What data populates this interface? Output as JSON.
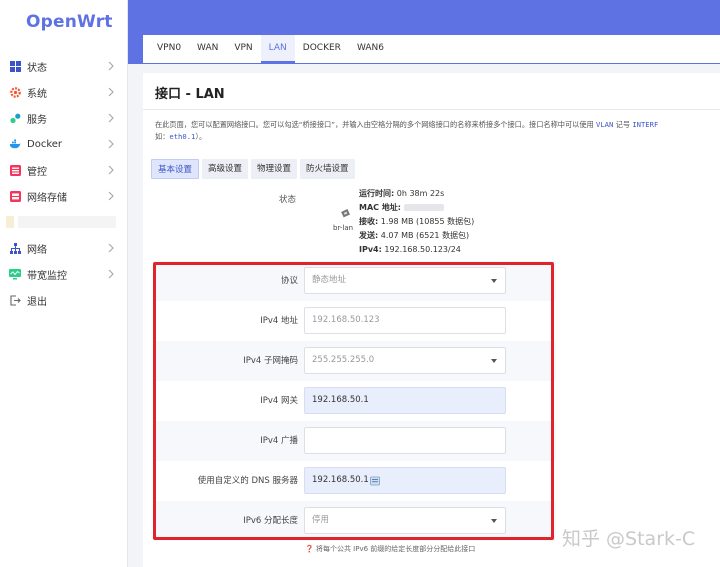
{
  "brand": {
    "name": "OpenWrt"
  },
  "sidebar": {
    "items": [
      {
        "label": "状态",
        "icon": "grid-icon"
      },
      {
        "label": "系统",
        "icon": "gear-icon"
      },
      {
        "label": "服务",
        "icon": "services-icon"
      },
      {
        "label": "Docker",
        "icon": "docker-icon"
      },
      {
        "label": "管控",
        "icon": "control-icon"
      },
      {
        "label": "网络存储",
        "icon": "storage-icon"
      },
      {
        "label": "网络",
        "icon": "network-icon"
      },
      {
        "label": "带宽监控",
        "icon": "monitor-icon"
      },
      {
        "label": "退出",
        "icon": "logout-icon"
      }
    ]
  },
  "tabs": [
    "VPN0",
    "WAN",
    "VPN",
    "LAN",
    "DOCKER",
    "WAN6"
  ],
  "page": {
    "title": "接口 - LAN",
    "desc_line1": "在此页面，您可以配置网络接口。您可以勾选“桥接接口”，并输入由空格分隔的多个网络接口的名称来桥接多个接口。接口名称中可以使用",
    "desc_vlan": "VLAN",
    "desc_line1_tail": "记号",
    "desc_interf": "INTERF",
    "desc_line2_pre": "如：",
    "desc_eth": "eth0.1",
    "desc_line2_post": "）。"
  },
  "subtabs": [
    "基本设置",
    "高级设置",
    "物理设置",
    "防火墙设置"
  ],
  "status": {
    "label": "状态",
    "device": "br-lan",
    "uptime_label": "运行时间:",
    "uptime_value": "0h 38m 22s",
    "mac_label": "MAC 地址:",
    "rx_label": "接收:",
    "rx_value": "1.98 MB (10855 数据包)",
    "tx_label": "发送:",
    "tx_value": "4.07 MB (6521 数据包)",
    "ipv4_label": "IPv4:",
    "ipv4_value": "192.168.50.123/24"
  },
  "form": {
    "protocol_label": "协议",
    "protocol_value": "静态地址",
    "ipv4_addr_label": "IPv4 地址",
    "ipv4_addr_value": "192.168.50.123",
    "netmask_label": "IPv4 子网掩码",
    "netmask_value": "255.255.255.0",
    "gateway_label": "IPv4 网关",
    "gateway_value": "192.168.50.1",
    "broadcast_label": "IPv4 广播",
    "broadcast_value": "",
    "dns_label": "使用自定义的 DNS 服务器",
    "dns_value": "192.168.50.1",
    "ipv6_len_label": "IPv6 分配长度",
    "ipv6_len_value": "停用",
    "ipv6_hint": "将每个公共 IPv6 前缀的给定长度部分分配给此接口"
  },
  "watermark": "知乎 @Stark-C",
  "colors": {
    "accent": "#5e72e4",
    "highlight": "#e0242c"
  }
}
